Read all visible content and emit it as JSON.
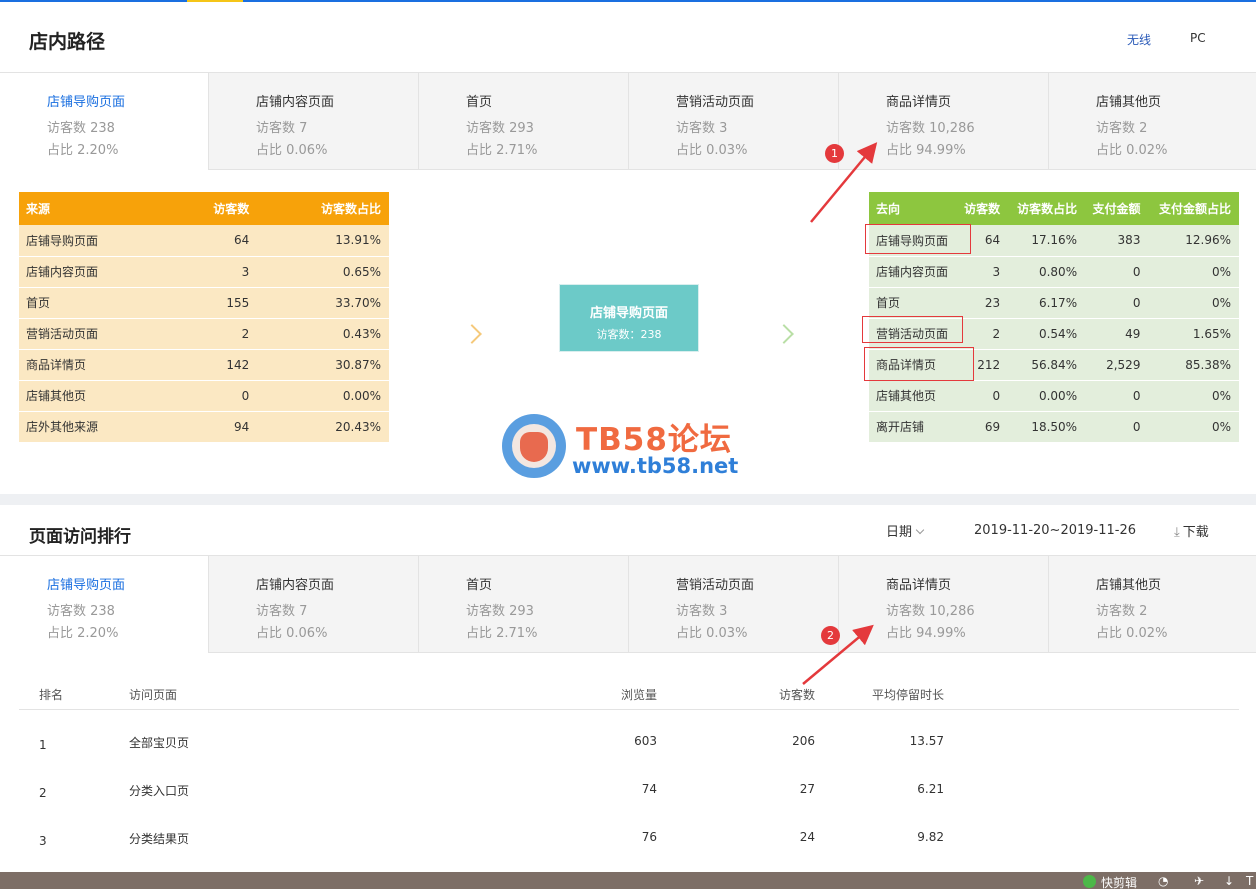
{
  "path_section": {
    "title": "店内路径",
    "devices": [
      "无线",
      "PC"
    ],
    "tabs": [
      {
        "name": "店铺导购页面",
        "visitors": "访客数 238",
        "ratio": "占比 2.20%"
      },
      {
        "name": "店铺内容页面",
        "visitors": "访客数 7",
        "ratio": "占比 0.06%"
      },
      {
        "name": "首页",
        "visitors": "访客数 293",
        "ratio": "占比 2.71%"
      },
      {
        "name": "营销活动页面",
        "visitors": "访客数 3",
        "ratio": "占比 0.03%"
      },
      {
        "name": "商品详情页",
        "visitors": "访客数 10,286",
        "ratio": "占比 94.99%"
      },
      {
        "name": "店铺其他页",
        "visitors": "访客数 2",
        "ratio": "占比 0.02%"
      }
    ],
    "source_table": {
      "headers": [
        "来源",
        "访客数",
        "访客数占比"
      ],
      "rows": [
        [
          "店铺导购页面",
          "64",
          "13.91%"
        ],
        [
          "店铺内容页面",
          "3",
          "0.65%"
        ],
        [
          "首页",
          "155",
          "33.70%"
        ],
        [
          "营销活动页面",
          "2",
          "0.43%"
        ],
        [
          "商品详情页",
          "142",
          "30.87%"
        ],
        [
          "店铺其他页",
          "0",
          "0.00%"
        ],
        [
          "店外其他来源",
          "94",
          "20.43%"
        ]
      ]
    },
    "center": {
      "name": "店铺导购页面",
      "visitors": "访客数：238"
    },
    "dest_table": {
      "headers": [
        "去向",
        "访客数",
        "访客数占比",
        "支付金额",
        "支付金额占比"
      ],
      "rows": [
        [
          "店铺导购页面",
          "64",
          "17.16%",
          "383",
          "12.96%"
        ],
        [
          "店铺内容页面",
          "3",
          "0.80%",
          "0",
          "0%"
        ],
        [
          "首页",
          "23",
          "6.17%",
          "0",
          "0%"
        ],
        [
          "营销活动页面",
          "2",
          "0.54%",
          "49",
          "1.65%"
        ],
        [
          "商品详情页",
          "212",
          "56.84%",
          "2,529",
          "85.38%"
        ],
        [
          "店铺其他页",
          "0",
          "0.00%",
          "0",
          "0%"
        ],
        [
          "离开店铺",
          "69",
          "18.50%",
          "0",
          "0%"
        ]
      ]
    }
  },
  "watermark": {
    "line1": "TB58论坛",
    "line2": "www.tb58.net"
  },
  "annotations": {
    "badge1": "1",
    "badge2": "2",
    "color": "#e4393c"
  },
  "ranking_section": {
    "title": "页面访问排行",
    "date_label": "日期",
    "date_range": "2019-11-20~2019-11-26",
    "download_label": "下载",
    "tabs": [
      {
        "name": "店铺导购页面",
        "visitors": "访客数 238",
        "ratio": "占比 2.20%"
      },
      {
        "name": "店铺内容页面",
        "visitors": "访客数 7",
        "ratio": "占比 0.06%"
      },
      {
        "name": "首页",
        "visitors": "访客数 293",
        "ratio": "占比 2.71%"
      },
      {
        "name": "营销活动页面",
        "visitors": "访客数 3",
        "ratio": "占比 0.03%"
      },
      {
        "name": "商品详情页",
        "visitors": "访客数 10,286",
        "ratio": "占比 94.99%"
      },
      {
        "name": "店铺其他页",
        "visitors": "访客数 2",
        "ratio": "占比 0.02%"
      }
    ],
    "table": {
      "headers": [
        "排名",
        "访问页面",
        "浏览量",
        "访客数",
        "平均停留时长"
      ],
      "rows": [
        [
          "1",
          "全部宝贝页",
          "603",
          "206",
          "13.57"
        ],
        [
          "2",
          "分类入口页",
          "74",
          "27",
          "6.21"
        ],
        [
          "3",
          "分类结果页",
          "76",
          "24",
          "9.82"
        ]
      ]
    }
  },
  "taskbar": {
    "app_label": "快剪辑",
    "trailing": "T"
  },
  "colors": {
    "accent": "#1a6fe0",
    "source_header": "#f7a20a",
    "dest_header": "#8dc63f",
    "center_box": "#6ccac8"
  }
}
